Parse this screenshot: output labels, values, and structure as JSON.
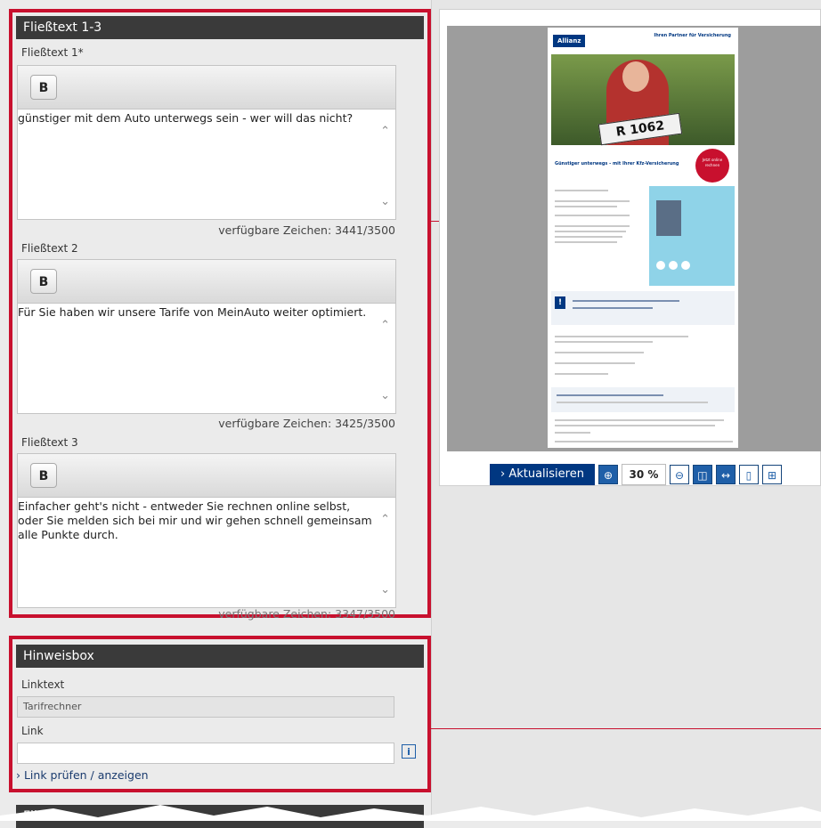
{
  "section_fliesstext": {
    "title": "Fließtext 1-3",
    "editors": [
      {
        "label": "Fließtext 1*",
        "bold_label": "B",
        "text": "günstiger mit dem Auto unterwegs sein - wer will das nicht?",
        "counter": "verfügbare Zeichen: 3441/3500"
      },
      {
        "label": "Fließtext 2",
        "bold_label": "B",
        "text": "Für Sie haben wir unsere Tarife von MeinAuto weiter optimiert.",
        "counter": "verfügbare Zeichen: 3425/3500"
      },
      {
        "label": "Fließtext 3",
        "bold_label": "B",
        "text": "Einfacher geht's nicht - entweder Sie rechnen online selbst, oder Sie melden sich bei mir und wir gehen schnell gemeinsam alle Punkte durch.",
        "counter": "verfügbare Zeichen: 3347/3500"
      }
    ]
  },
  "section_hinweis": {
    "title": "Hinweisbox",
    "linktext_label": "Linktext",
    "linktext_value": "Tarifrechner",
    "link_label": "Link",
    "link_value": "",
    "info_icon": "i",
    "check_link": "› Link prüfen / anzeigen"
  },
  "next_section_title": "Fließ",
  "preview": {
    "refresh_label": "› Aktualisieren",
    "zoom_level": "30 %",
    "mail": {
      "brand": "Allianz",
      "header_text": "Ihren Partner für Versicherung",
      "plate": "R 1062",
      "badge": "Jetzt online rechnen",
      "headline": "Günstiger unterwegs - mit Ihrer Kfz-Versicherung"
    }
  },
  "colors": {
    "accent_red": "#c8102e",
    "header_dark": "#3a3a3a",
    "allianz_blue": "#003781"
  }
}
